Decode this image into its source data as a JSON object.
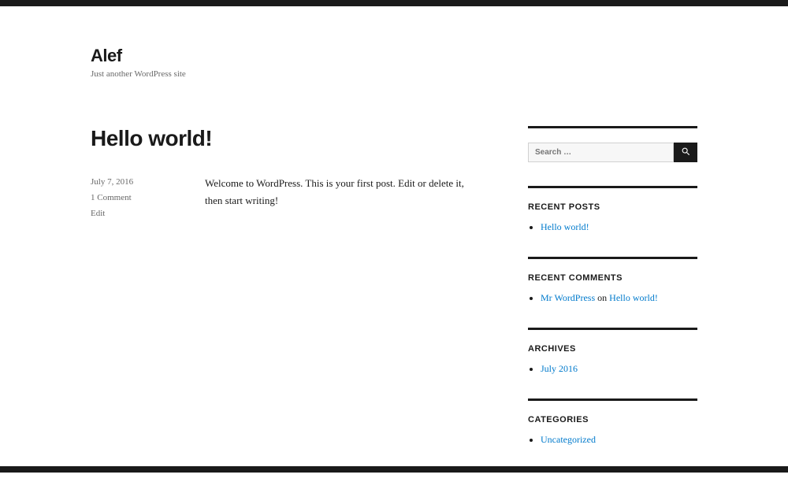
{
  "site": {
    "title": "Alef",
    "tagline": "Just another WordPress site"
  },
  "post": {
    "title": "Hello world!",
    "date": "July 7, 2016",
    "comments": "1 Comment",
    "edit": "Edit",
    "content": "Welcome to WordPress. This is your first post. Edit or delete it, then start writing!"
  },
  "sidebar": {
    "search": {
      "placeholder": "Search …"
    },
    "recentPosts": {
      "title": "Recent Posts",
      "items": [
        "Hello world!"
      ]
    },
    "recentComments": {
      "title": "Recent Comments",
      "author": "Mr WordPress",
      "on": " on ",
      "target": "Hello world!"
    },
    "archives": {
      "title": "Archives",
      "items": [
        "July 2016"
      ]
    },
    "categories": {
      "title": "Categories",
      "items": [
        "Uncategorized"
      ]
    }
  }
}
